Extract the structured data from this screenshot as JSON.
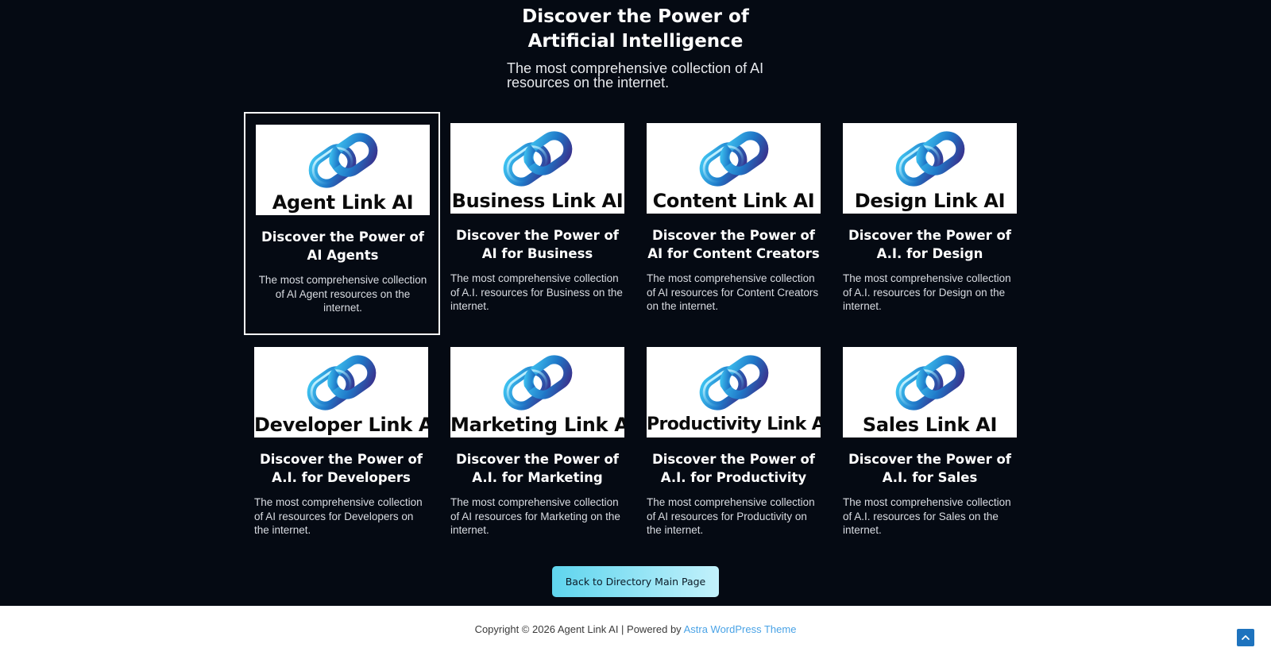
{
  "hero": {
    "title_line1": "Discover the Power of",
    "title_line2": "Artificial Intelligence",
    "subtitle": "The most comprehensive collection of AI resources on the internet."
  },
  "cards": [
    {
      "logo_text": "Agent Link AI",
      "title": "Discover the Power of AI Agents",
      "description": "The most comprehensive collection of AI Agent resources on the internet.",
      "selected": true
    },
    {
      "logo_text": "Business Link AI",
      "title": "Discover the Power of AI for Business",
      "description": "The most comprehensive collection of A.I. resources for Business on the internet."
    },
    {
      "logo_text": "Content Link AI",
      "title": "Discover the Power of AI for Content Creators",
      "description": "The most comprehensive collection of AI resources for Content Creators on the internet."
    },
    {
      "logo_text": "Design Link AI",
      "title": "Discover the Power of A.I. for Design",
      "description": "The most comprehensive collection of A.I. resources for Design on the internet."
    },
    {
      "logo_text": "Developer Link AI",
      "title": "Discover the Power of A.I. for Developers",
      "description": "The most comprehensive collection of AI resources for Developers on the internet."
    },
    {
      "logo_text": "Marketing Link AI",
      "title": "Discover the Power of A.I. for Marketing",
      "description": "The most comprehensive collection of AI resources for Marketing on the internet."
    },
    {
      "logo_text": "Productivity Link AI",
      "title": "Discover the Power of A.I. for Productivity",
      "description": "The most comprehensive collection of AI resources for Productivity on the internet."
    },
    {
      "logo_text": "Sales Link AI",
      "title": "Discover the Power of A.I. for Sales",
      "description": "The most comprehensive collection of A.I. resources for Sales on the internet."
    }
  ],
  "back_button": "Back to Directory Main Page",
  "footer": {
    "copyright": "Copyright © 2026 Agent Link AI | Powered by ",
    "theme_link": "Astra WordPress Theme"
  },
  "icons": {
    "logo": "chain-link-icon",
    "scroll_top": "chevron-up-icon"
  },
  "colors": {
    "background": "#050a13",
    "button_start": "#5fd5ee",
    "button_end": "#c2f1fb",
    "link": "#4aa3e6",
    "scroll_top": "#1e73be"
  }
}
